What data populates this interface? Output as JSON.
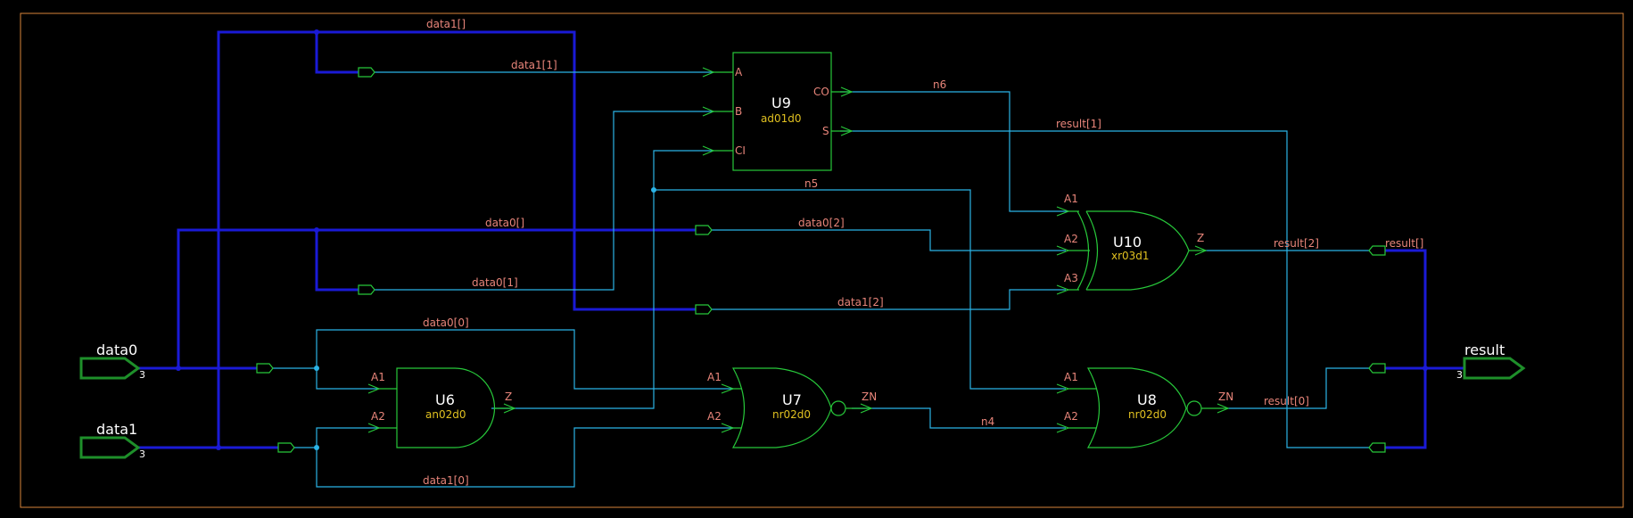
{
  "ports": {
    "data0": {
      "name": "data0",
      "width": "3"
    },
    "data1": {
      "name": "data1",
      "width": "3"
    },
    "result": {
      "name": "result",
      "width": "3"
    }
  },
  "instances": {
    "U9": {
      "name": "U9",
      "cell": "ad01d0",
      "pins": [
        "A",
        "B",
        "CI",
        "CO",
        "S"
      ]
    },
    "U10": {
      "name": "U10",
      "cell": "xr03d1",
      "pins": [
        "A1",
        "A2",
        "A3",
        "Z"
      ]
    },
    "U6": {
      "name": "U6",
      "cell": "an02d0",
      "pins": [
        "A1",
        "A2",
        "Z"
      ]
    },
    "U7": {
      "name": "U7",
      "cell": "nr02d0",
      "pins": [
        "A1",
        "A2",
        "ZN"
      ]
    },
    "U8": {
      "name": "U8",
      "cell": "nr02d0",
      "pins": [
        "A1",
        "A2",
        "ZN"
      ]
    }
  },
  "nets": {
    "data1_bus": "data1[]",
    "data1_1": "data1[1]",
    "n6": "n6",
    "result_1": "result[1]",
    "n5": "n5",
    "data0_bus": "data0[]",
    "data0_2": "data0[2]",
    "result_2": "result[2]",
    "result_bus": "result[]",
    "data0_1": "data0[1]",
    "data1_2": "data1[2]",
    "data0_0": "data0[0]",
    "n4": "n4",
    "result_0": "result[0]",
    "data1_0": "data1[0]"
  },
  "colors": {
    "wire": "#2bb3e6",
    "bus": "#1a1ad6",
    "gate": "#27c83a",
    "frame": "#d9843a",
    "net_label": "#e8857a",
    "cell_label": "#e0c020"
  }
}
